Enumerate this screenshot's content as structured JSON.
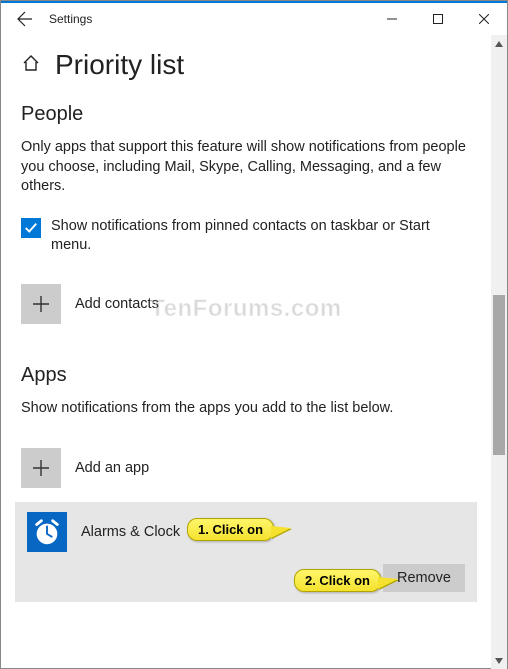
{
  "window": {
    "title": "Settings"
  },
  "page": {
    "title": "Priority list"
  },
  "people": {
    "heading": "People",
    "description": "Only apps that support this feature will show notifications from people you choose, including Mail, Skype, Calling, Messaging, and a few others.",
    "checkbox_label": "Show notifications from pinned contacts on taskbar or Start menu.",
    "checkbox_checked": true,
    "add_label": "Add contacts"
  },
  "apps": {
    "heading": "Apps",
    "description": "Show notifications from the apps you add to the list below.",
    "add_label": "Add an app",
    "items": [
      {
        "name": "Alarms & Clock",
        "remove_label": "Remove"
      }
    ]
  },
  "annotations": {
    "callout1": "1. Click on",
    "callout2": "2. Click on"
  },
  "watermark": "TenForums.com"
}
